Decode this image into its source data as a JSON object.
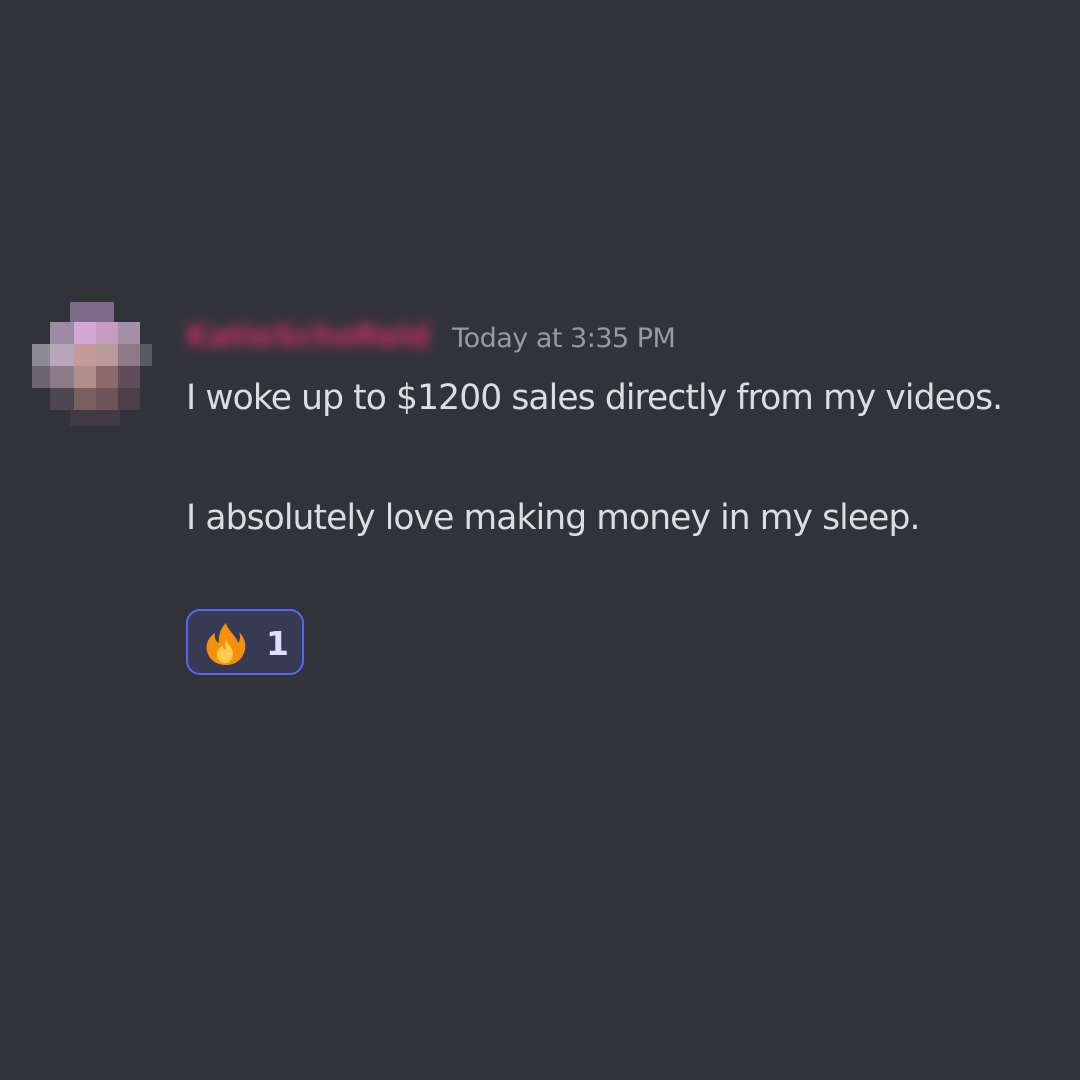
{
  "message": {
    "author": "KatieSchofield",
    "timestamp": "Today at 3:35 PM",
    "lines": [
      "I woke up to $1200 sales directly from my videos.",
      "I absolutely love making money in my sleep."
    ],
    "reactions": [
      {
        "emoji": "fire-icon",
        "count": "1"
      }
    ]
  },
  "colors": {
    "background": "#313338",
    "username": "#e8306e",
    "timestamp": "#949ba4",
    "text": "#dbdee1",
    "reaction_border": "#5865f2",
    "reaction_bg": "#373a53"
  }
}
